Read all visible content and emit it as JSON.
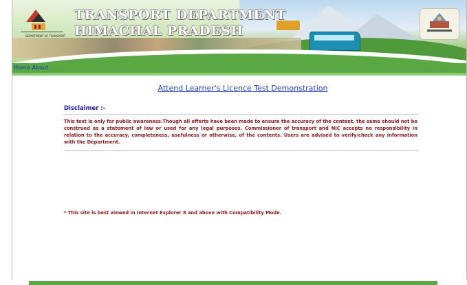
{
  "header": {
    "title_line1": "TRANSPORT DEPARTMENT",
    "title_line2": "HIMACHAL PRADESH",
    "logo_text": "DEPARTMENT OF TRANSPORT"
  },
  "nav": {
    "items": [
      "Home",
      "About"
    ]
  },
  "main": {
    "demo_link": "Attend Learner's Licence Test Demonstration",
    "disclaimer_heading": "Disclaimer :-",
    "disclaimer_text": "This test is only for public awareness.Though all efforts have been made to ensure the accuracy of the content, the same should not be construed as a statement of law or used for any legal purposes. Commissioner of transport and NIC accepts no responsibility in relation to the accuracy, completeness, usefulness or otherwise, of the contents. Users are advised to verify/check any information with the Department.",
    "browser_note": "* This site is best viewed in Internet Explorer 8 and above with Compatibility Mode."
  },
  "colors": {
    "nav_green": "#5aa844",
    "link_blue": "#1f3fbf",
    "heading_blue": "#1c1ca6",
    "text_maroon": "#8b1a1a"
  },
  "icons": {
    "logo": "transport-department-logo-icon",
    "emblem": "himachal-state-emblem-icon"
  }
}
